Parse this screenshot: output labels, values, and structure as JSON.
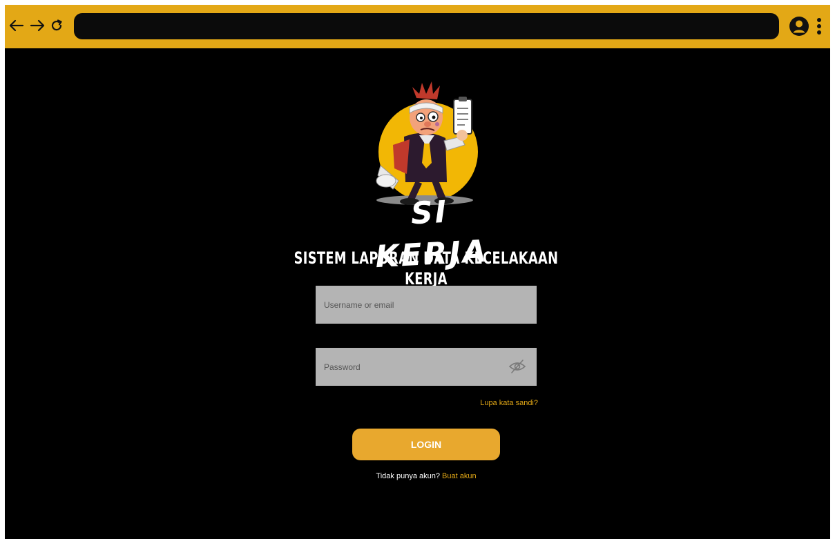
{
  "browser": {
    "back_icon": "arrow-left-icon",
    "forward_icon": "arrow-right-icon",
    "reload_icon": "reload-icon",
    "address_value": "",
    "profile_icon": "user-circle-icon",
    "menu_icon": "vertical-dots-icon"
  },
  "brand": {
    "logo_icon": "mascot-logo-icon",
    "name": "SI KERJA",
    "system_title": "SISTEM LAPORAN DATA KECELAKAAN KERJA"
  },
  "login_form": {
    "username_placeholder": "Username or email",
    "password_placeholder": "Password",
    "toggle_password_icon": "eye-slash-icon",
    "forgot_password_label": "Lupa kata sandi?",
    "login_button_label": "LOGIN",
    "no_account_text": "Tidak punya akun?",
    "create_account_label": "Buat akun"
  },
  "colors": {
    "accent": "#E3A816",
    "button": "#E8A82E",
    "background": "#000000",
    "input_background": "#B4B4B4"
  }
}
